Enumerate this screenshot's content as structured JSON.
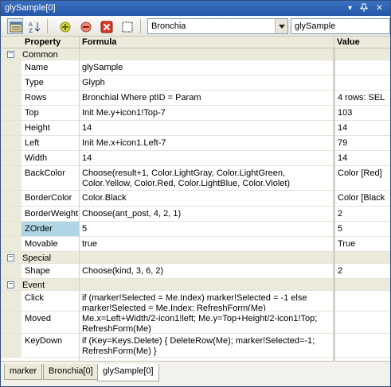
{
  "window": {
    "title": "glySample[0]"
  },
  "titlebar_icons": {
    "dropdown": "dropdown-arrow-icon",
    "pin": "pin-icon",
    "close": "close-icon"
  },
  "toolbar": {
    "tools": [
      {
        "name": "categorized-view-icon",
        "pressed": true
      },
      {
        "name": "sort-alphabetical-icon",
        "pressed": false
      },
      {
        "name": "add-icon",
        "pressed": false
      },
      {
        "name": "remove-icon",
        "pressed": false
      },
      {
        "name": "delete-icon",
        "pressed": false
      },
      {
        "name": "select-icon",
        "pressed": false
      }
    ],
    "combo_value": "Bronchia",
    "text_value": "glySample"
  },
  "grid": {
    "headers": {
      "property": "Property",
      "formula": "Formula",
      "value": "Value"
    },
    "categories": {
      "common": "Common",
      "special": "Special",
      "event": "Event"
    },
    "rows": {
      "name": {
        "property": "Name",
        "formula": "glySample",
        "value": ""
      },
      "type": {
        "property": "Type",
        "formula": "Glyph",
        "value": ""
      },
      "rows": {
        "property": "Rows",
        "formula": "Bronchial Where  ptID = Param",
        "value": "4 rows: SEL"
      },
      "top": {
        "property": "Top",
        "formula": "Init Me.y+icon1!Top-7",
        "value": "103"
      },
      "height": {
        "property": "Height",
        "formula": "14",
        "value": "14"
      },
      "left": {
        "property": "Left",
        "formula": "Init Me.x+icon1.Left-7",
        "value": "79"
      },
      "width": {
        "property": "Width",
        "formula": "14",
        "value": "14"
      },
      "backcolor": {
        "property": "BackColor",
        "formula": "Choose(result+1, Color.LightGray, Color.LightGreen,\nColor.Yellow,   Color.Red, Color.LightBlue, Color.Violet)",
        "value": "Color [Red]"
      },
      "bordercolor": {
        "property": "BorderColor",
        "formula": "Color.Black",
        "value": "Color [Black"
      },
      "borderweight": {
        "property": "BorderWeight",
        "formula": "Choose(ant_post, 4, 2, 1)",
        "value": "2"
      },
      "zorder": {
        "property": "ZOrder",
        "formula": "5",
        "value": "5"
      },
      "movable": {
        "property": "Movable",
        "formula": "true",
        "value": "True"
      },
      "shape": {
        "property": "Shape",
        "formula": "Choose(kind, 3, 6, 2)",
        "value": "2"
      },
      "click": {
        "property": "Click",
        "formula": "if (marker!Selected = Me.Index) marker!Selected = -1 else\n    marker!Selected = Me.Index; RefreshForm(Me)",
        "value": ""
      },
      "moved": {
        "property": "Moved",
        "formula": "Me.x=Left+Width/2-icon1!left; Me.y=Top+Height/2-icon1!Top;\nRefreshForm(Me)",
        "value": ""
      },
      "keydown": {
        "property": "KeyDown",
        "formula": "if (Key=Keys.Delete) { DeleteRow(Me); marker!Selected=-1;\nRefreshForm(Me) }",
        "value": ""
      }
    }
  },
  "tabs": [
    "marker",
    "Bronchia[0]",
    "glySample[0]"
  ],
  "colors": {
    "title_bar": "#2557a8",
    "selected_property": "#b0d6e6",
    "gutter": "#ebeadb"
  }
}
